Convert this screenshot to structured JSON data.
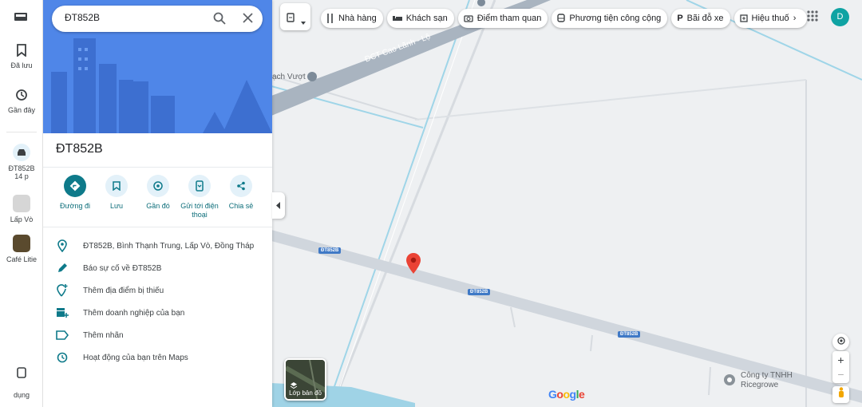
{
  "search": {
    "value": "ĐT852B"
  },
  "rail": {
    "items": [
      {
        "label": "Đã lưu",
        "icon": "bookmark-icon"
      },
      {
        "label": "Gần đây",
        "icon": "history-icon"
      }
    ],
    "recent": [
      {
        "label": "ĐT852B",
        "sub": "14 p"
      },
      {
        "label": "Lấp Vò"
      },
      {
        "label": "Café Litie"
      }
    ],
    "bottom": {
      "label": "dụng"
    }
  },
  "place": {
    "title": "ĐT852B"
  },
  "actions": [
    {
      "label": "Đường đi",
      "icon": "directions-icon"
    },
    {
      "label": "Lưu",
      "icon": "bookmark-icon"
    },
    {
      "label": "Gần đó",
      "icon": "nearby-icon"
    },
    {
      "label": "Gửi tới điện thoại",
      "icon": "send-to-phone-icon"
    },
    {
      "label": "Chia sẻ",
      "icon": "share-icon"
    }
  ],
  "info": [
    {
      "text": "ĐT852B, Bình Thạnh Trung, Lấp Vò, Đồng Tháp",
      "icon": "location-pin-icon"
    },
    {
      "text": "Báo sự cố về ĐT852B",
      "icon": "pencil-icon"
    },
    {
      "text": "Thêm địa điểm bị thiếu",
      "icon": "add-location-icon"
    },
    {
      "text": "Thêm doanh nghiệp của bạn",
      "icon": "add-business-icon"
    },
    {
      "text": "Thêm nhãn",
      "icon": "label-icon"
    },
    {
      "text": "Hoạt động của bạn trên Maps",
      "icon": "history-icon"
    }
  ],
  "chips": [
    {
      "label": "Nhà hàng",
      "icon": "restaurant-icon"
    },
    {
      "label": "Khách sạn",
      "icon": "hotel-icon"
    },
    {
      "label": "Điểm tham quan",
      "icon": "camera-icon"
    },
    {
      "label": "Phương tiện công cộng",
      "icon": "transit-icon"
    },
    {
      "label": "Bãi đỗ xe",
      "icon": "parking-icon"
    },
    {
      "label": "Hiệu thuố",
      "icon": "pharmacy-icon"
    }
  ],
  "map": {
    "road_labels": [
      "ĐT852B",
      "ĐT852B",
      "ĐT852B"
    ],
    "street_text": "ĐCT Cao Lãnh - Lộ",
    "overpass_text": "ạch Vượt",
    "poi": {
      "line1": "Công ty TNHH",
      "line2": "Ricegrowe"
    },
    "layer_label": "Lớp bản đồ",
    "logo": "Google"
  },
  "user": {
    "initial": "D"
  },
  "colors": {
    "accent": "#0e7a8a",
    "hero": "#4f86e8",
    "pin": "#ea4335"
  }
}
